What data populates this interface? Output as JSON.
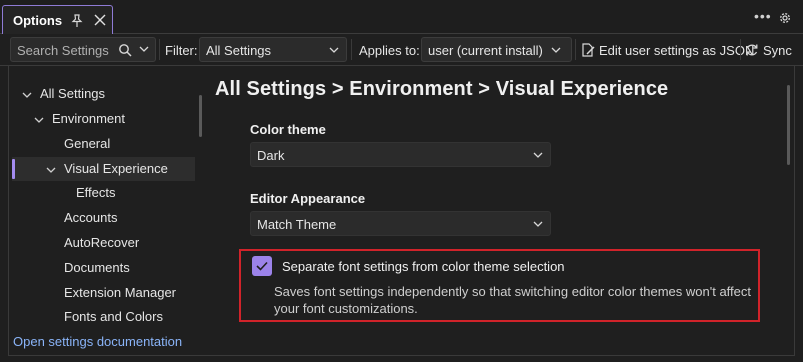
{
  "window": {
    "tab_title": "Options"
  },
  "toolbar": {
    "search_placeholder": "Search Settings",
    "filter_label": "Filter:",
    "filter_value": "All Settings",
    "applies_label": "Applies to:",
    "applies_value": "user (current install)",
    "edit_json_label": "Edit user settings as JSON",
    "sync_label": "Sync"
  },
  "sidebar": {
    "items": [
      {
        "label": "All Settings",
        "expanded": true
      },
      {
        "label": "Environment",
        "expanded": true
      },
      {
        "label": "General"
      },
      {
        "label": "Visual Experience",
        "expanded": true,
        "selected": true
      },
      {
        "label": "Effects"
      },
      {
        "label": "Accounts"
      },
      {
        "label": "AutoRecover"
      },
      {
        "label": "Documents"
      },
      {
        "label": "Extension Manager"
      },
      {
        "label": "Fonts and Colors"
      }
    ],
    "footer_link": "Open settings documentation"
  },
  "main": {
    "breadcrumb": "All Settings > Environment > Visual Experience",
    "color_theme": {
      "label": "Color theme",
      "value": "Dark"
    },
    "editor_appearance": {
      "label": "Editor Appearance",
      "value": "Match Theme"
    },
    "separate_fonts": {
      "label": "Separate font settings from color theme selection",
      "description": "Saves font settings independently so that switching editor color themes won't affect your font customizations.",
      "checked": true
    }
  },
  "colors": {
    "accent": "#9c83ea",
    "highlight": "#d1232a",
    "link": "#8ab4f8"
  }
}
